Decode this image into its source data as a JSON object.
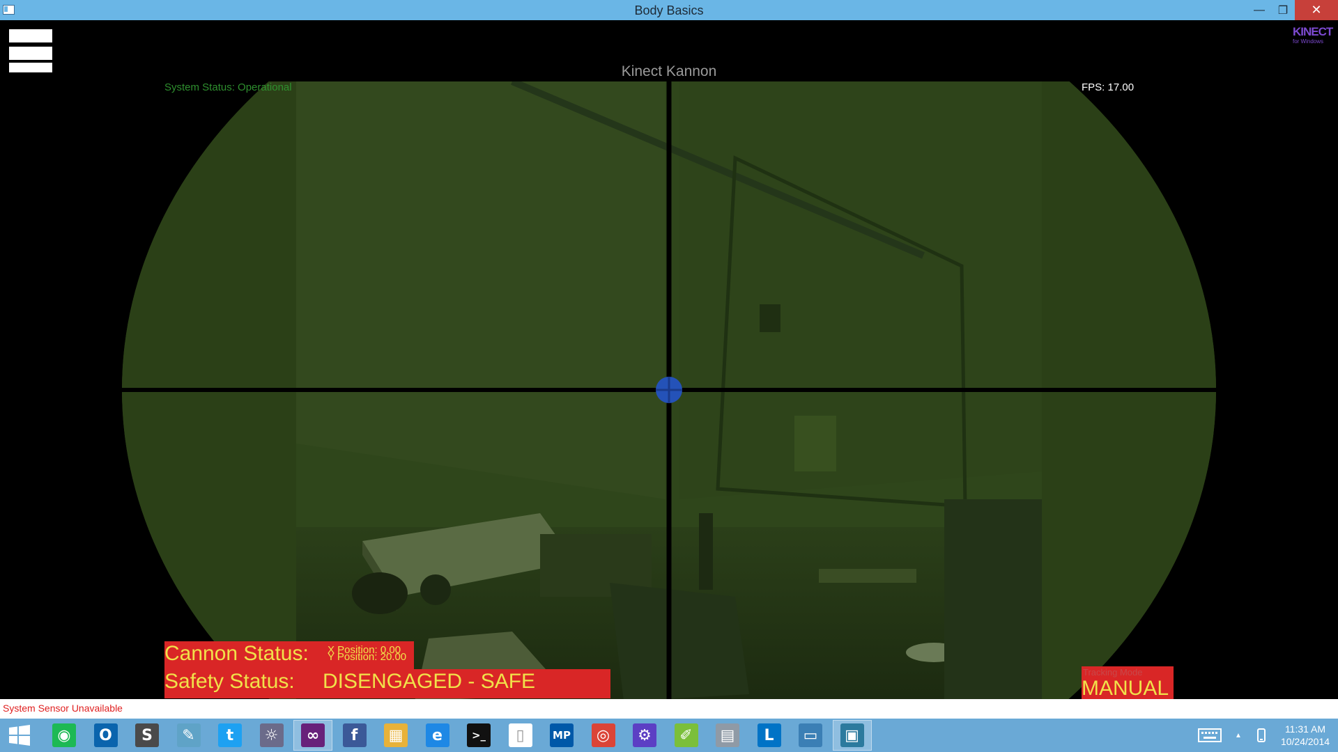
{
  "window": {
    "title": "Body Basics",
    "minimize_label": "—",
    "maximize_label": "❐",
    "close_label": "✕"
  },
  "app": {
    "camera_title": "Kinect Kannon",
    "system_status": "System Status: Operational",
    "fps": "FPS: 17.00",
    "kinect_logo_line1": "KINECT",
    "kinect_logo_line2": "for Windows",
    "cannon_status_label": "Cannon Status:",
    "x_position": "X Position: 0.00",
    "y_position": "Y Position: 20.00",
    "safety_status_label": "Safety Status:",
    "safety_status_value": "DISENGAGED - SAFE",
    "tracking_mode_label": "Tracking Mode",
    "tracking_mode_value": "MANUAL"
  },
  "status_bar": {
    "text": "System Sensor Unavailable"
  },
  "colors": {
    "titlebar": "#6ab6e6",
    "night_vision": "#2d4219",
    "alert_red": "#d92626",
    "status_yellow": "#f1e14a",
    "status_green": "#2e8f2e",
    "crosshair_center": "#2452b8",
    "taskbar": "#6aa9d6"
  },
  "taskbar": {
    "start_icon": "windows-start-icon",
    "apps": [
      {
        "name": "spotify-icon",
        "glyph": "◉"
      },
      {
        "name": "outlook-icon",
        "glyph": "O"
      },
      {
        "name": "sublime-text-icon",
        "glyph": "S"
      },
      {
        "name": "notepad-icon",
        "glyph": "✎"
      },
      {
        "name": "twitter-icon",
        "glyph": "t"
      },
      {
        "name": "mouse-tool-icon",
        "glyph": "☼"
      },
      {
        "name": "visual-studio-icon",
        "glyph": "∞"
      },
      {
        "name": "facebook-icon",
        "glyph": "f"
      },
      {
        "name": "file-explorer-icon",
        "glyph": "▦"
      },
      {
        "name": "internet-explorer-icon",
        "glyph": "e"
      },
      {
        "name": "command-prompt-icon",
        "glyph": ">_"
      },
      {
        "name": "blank-document-icon",
        "glyph": "▯"
      },
      {
        "name": "mp-icon",
        "glyph": "MP"
      },
      {
        "name": "chrome-icon",
        "glyph": "◎"
      },
      {
        "name": "settings-icon",
        "glyph": "⚙"
      },
      {
        "name": "notes-app-icon",
        "glyph": "✐"
      },
      {
        "name": "calculator-icon",
        "glyph": "▤"
      },
      {
        "name": "lync-icon",
        "glyph": "L"
      },
      {
        "name": "photos-icon",
        "glyph": "▭"
      },
      {
        "name": "kinect-app-icon",
        "glyph": "▣"
      }
    ],
    "clock_time": "11:31 AM",
    "clock_date": "10/24/2014",
    "tray_keyboard_icon": "keyboard-icon",
    "tray_chevron": "▲",
    "tray_device_icon": "device-icon"
  }
}
